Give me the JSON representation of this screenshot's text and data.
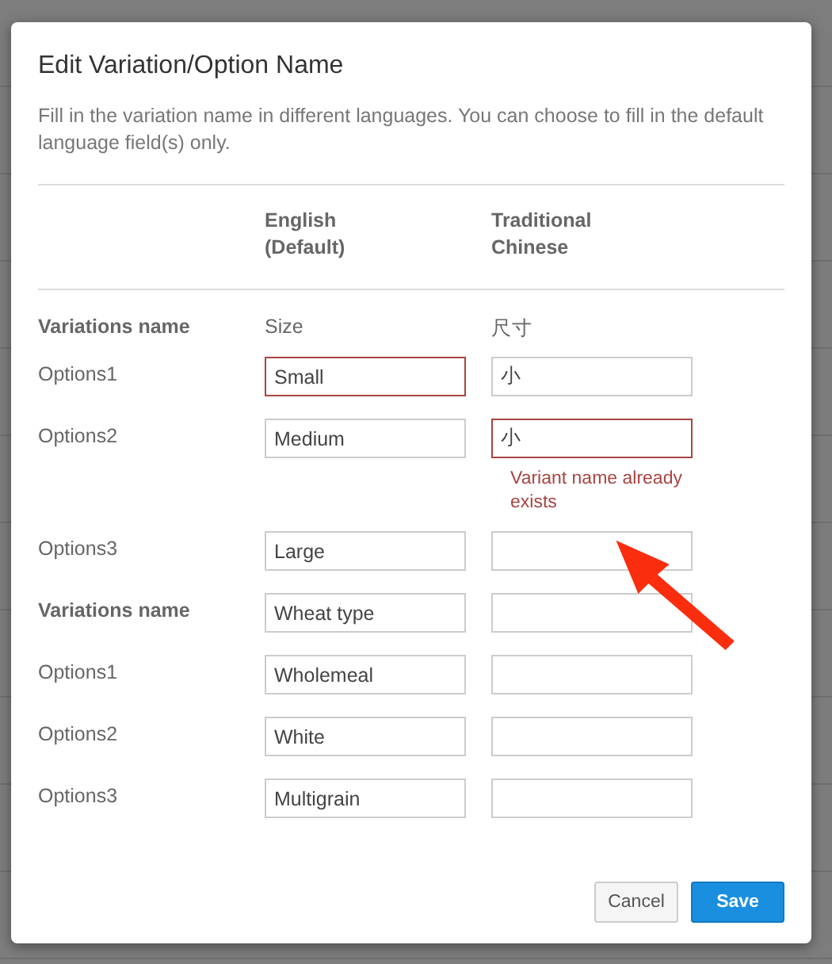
{
  "dialog": {
    "title": "Edit Variation/Option Name",
    "description": "Fill in the variation name in different languages. You can choose to fill in the default language field(s) only.",
    "columns": [
      "English (Default)",
      "Traditional Chinese"
    ],
    "rows": [
      {
        "kind": "group",
        "label": "Variations name",
        "cells": [
          {
            "kind": "text",
            "value": "Size"
          },
          {
            "kind": "text",
            "value": "尺寸"
          }
        ]
      },
      {
        "kind": "option",
        "label": "Options1",
        "cells": [
          {
            "kind": "field",
            "value": "Small",
            "error": true
          },
          {
            "kind": "field",
            "value": "小",
            "error": false
          }
        ]
      },
      {
        "kind": "option",
        "label": "Options2",
        "cells": [
          {
            "kind": "field",
            "value": "Medium",
            "error": false
          },
          {
            "kind": "field",
            "value": "小",
            "error": true,
            "message": "Variant name already exists"
          }
        ]
      },
      {
        "kind": "option",
        "label": "Options3",
        "cells": [
          {
            "kind": "field",
            "value": "Large",
            "error": false
          },
          {
            "kind": "field",
            "error": false
          }
        ]
      },
      {
        "kind": "group",
        "label": "Variations name",
        "cells": [
          {
            "kind": "field",
            "value": "Wheat type",
            "error": false
          },
          {
            "kind": "field",
            "error": false
          }
        ]
      },
      {
        "kind": "option",
        "label": "Options1",
        "cells": [
          {
            "kind": "field",
            "value": "Wholemeal",
            "error": false
          },
          {
            "kind": "field",
            "error": false
          }
        ]
      },
      {
        "kind": "option",
        "label": "Options2",
        "cells": [
          {
            "kind": "field",
            "value": "White",
            "error": false
          },
          {
            "kind": "field",
            "error": false
          }
        ]
      },
      {
        "kind": "option",
        "label": "Options3",
        "cells": [
          {
            "kind": "field",
            "value": "Multigrain",
            "error": false
          },
          {
            "kind": "field",
            "error": false
          }
        ]
      }
    ],
    "buttons": [
      {
        "label": "Cancel",
        "kind": "secondary"
      },
      {
        "label": "Save",
        "kind": "primary"
      }
    ]
  }
}
